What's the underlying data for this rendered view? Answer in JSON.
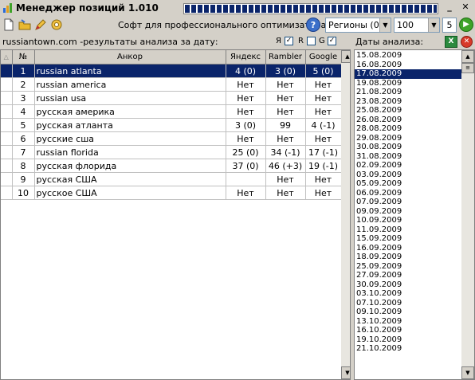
{
  "window": {
    "title": "Менеджер позиций 1.010",
    "progress": 1.0
  },
  "toolbar": {
    "soft_label": "Софт для профессионального оптимизатора",
    "help_label": "?",
    "regions_value": "Регионы (0)",
    "depth_value": "100",
    "spin_value": "5"
  },
  "info": {
    "site_text": "russiantown.com -результаты анализа за дату:",
    "engine_y": "Я",
    "engine_r": "R",
    "engine_g": "G",
    "dates_label": "Даты анализа:"
  },
  "table": {
    "columns": [
      "№",
      "Анкор",
      "Яндекс",
      "Rambler",
      "Google"
    ],
    "rows": [
      [
        "1",
        "russian atlanta",
        "4 (0)",
        "3 (0)",
        "5 (0)"
      ],
      [
        "2",
        "russian america",
        "Нет",
        "Нет",
        "Нет"
      ],
      [
        "3",
        "russian usa",
        "Нет",
        "Нет",
        "Нет"
      ],
      [
        "4",
        "русская америка",
        "Нет",
        "Нет",
        "Нет"
      ],
      [
        "5",
        "русская атланта",
        "3 (0)",
        "99",
        "4 (-1)"
      ],
      [
        "6",
        "русские сша",
        "Нет",
        "Нет",
        "Нет"
      ],
      [
        "7",
        "russian florida",
        "25 (0)",
        "34 (-1)",
        "17 (-1)"
      ],
      [
        "8",
        "русская флорида",
        "37 (0)",
        "46 (+3)",
        "19 (-1)"
      ],
      [
        "9",
        "русская США",
        "",
        "Нет",
        "Нет"
      ],
      [
        "10",
        "русское США",
        "Нет",
        "Нет",
        "Нет"
      ]
    ]
  },
  "dates": [
    "15.08.2009",
    "16.08.2009",
    "17.08.2009",
    "19.08.2009",
    "21.08.2009",
    "23.08.2009",
    "25.08.2009",
    "26.08.2009",
    "28.08.2009",
    "29.08.2009",
    "30.08.2009",
    "31.08.2009",
    "02.09.2009",
    "03.09.2009",
    "05.09.2009",
    "06.09.2009",
    "07.09.2009",
    "09.09.2009",
    "10.09.2009",
    "11.09.2009",
    "15.09.2009",
    "16.09.2009",
    "18.09.2009",
    "25.09.2009",
    "27.09.2009",
    "30.09.2009",
    "03.10.2009",
    "07.10.2009",
    "09.10.2009",
    "13.10.2009",
    "16.10.2009",
    "19.10.2009",
    "21.10.2009"
  ],
  "selected_date_index": 2
}
